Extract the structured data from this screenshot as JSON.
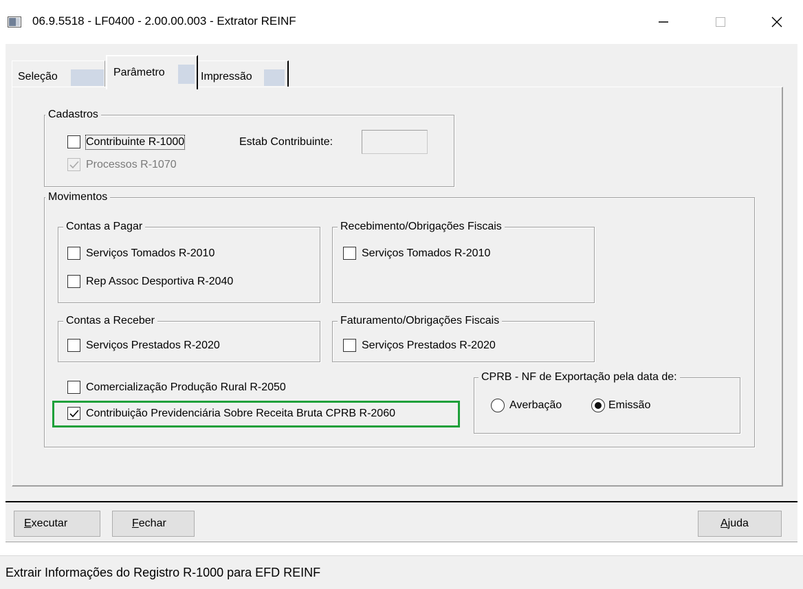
{
  "window": {
    "title": "06.9.5518 - LF0400 - 2.00.00.003 - Extrator REINF"
  },
  "tabs": [
    {
      "label": "Seleção"
    },
    {
      "label": "Parâmetro"
    },
    {
      "label": "Impressão"
    }
  ],
  "cadastros": {
    "title": "Cadastros",
    "contribuinte": {
      "label": "Contribuinte R-1000",
      "checked": false
    },
    "estab_label": "Estab Contribuinte:",
    "estab_value": "",
    "processos": {
      "label": "Processos R-1070",
      "checked": true,
      "enabled": false
    }
  },
  "movimentos": {
    "title": "Movimentos",
    "contas_pagar": {
      "title": "Contas a Pagar",
      "servicos_tomados": {
        "label": "Serviços Tomados R-2010",
        "checked": false
      },
      "rep_assoc": {
        "label": "Rep Assoc Desportiva R-2040",
        "checked": false
      }
    },
    "recebimento": {
      "title": "Recebimento/Obrigações Fiscais",
      "servicos_tomados": {
        "label": "Serviços Tomados R-2010",
        "checked": false
      }
    },
    "contas_receber": {
      "title": "Contas a Receber",
      "servicos_prestados": {
        "label": "Serviços Prestados R-2020",
        "checked": false
      }
    },
    "faturamento": {
      "title": "Faturamento/Obrigações Fiscais",
      "servicos_prestados": {
        "label": "Serviços Prestados R-2020",
        "checked": false
      }
    },
    "comercializacao": {
      "label": "Comercialização Produção Rural R-2050",
      "checked": false
    },
    "contribuicao": {
      "label": "Contribuição Previdenciária Sobre Receita Bruta CPRB R-2060",
      "checked": true
    },
    "cprb": {
      "title": "CPRB - NF de Exportação pela data de:",
      "options": [
        "Averbação",
        "Emissão"
      ],
      "selected": "Emissão"
    }
  },
  "buttons": {
    "executar": "Executar",
    "fechar": "Fechar",
    "ajuda": "Ajuda"
  },
  "status": "Extrair Informações do Registro R-1000 para EFD REINF",
  "colors": {
    "highlight": "#1fa03a",
    "panel": "#f0f0f0"
  }
}
